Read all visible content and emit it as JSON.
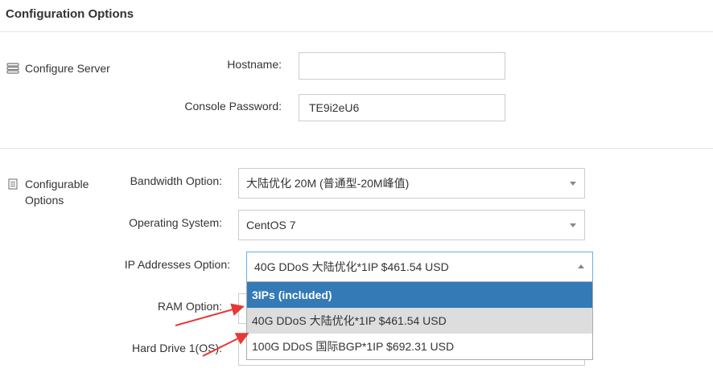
{
  "header": {
    "title": "Configuration Options"
  },
  "configure_server": {
    "label": "Configure Server",
    "hostname": {
      "label": "Hostname:",
      "value": "",
      "placeholder": ""
    },
    "console_password": {
      "label": "Console Password:",
      "value": "TE9i2eU6"
    }
  },
  "configurable_options": {
    "label_line1": "Configurable",
    "label_line2": "Options",
    "bandwidth": {
      "label": "Bandwidth Option:",
      "selected": "大陆优化 20M (普通型-20M峰值)"
    },
    "os": {
      "label": "Operating System:",
      "selected": "CentOS 7"
    },
    "ip": {
      "label": "IP Addresses Option:",
      "selected": "40G DDoS 大陆优化*1IP $461.54 USD",
      "options": [
        "3IPs (included)",
        "40G DDoS 大陆优化*1IP $461.54 USD",
        "100G DDoS 国际BGP*1IP $692.31 USD"
      ]
    },
    "ram": {
      "label": "RAM Option:"
    },
    "hard_drive": {
      "label": "Hard Drive 1(OS):"
    }
  },
  "colors": {
    "highlight": "#337ab7",
    "selected_option": "#dddddd",
    "annotation_arrow": "#e53935"
  },
  "icons": {
    "server": "server-icon",
    "options": "list-icon",
    "caret": "caret-icon"
  }
}
